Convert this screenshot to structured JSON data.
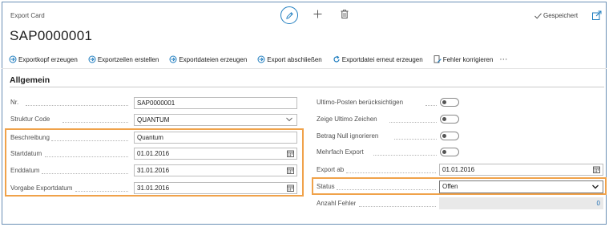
{
  "header": {
    "caption": "Export Card",
    "title": "SAP0000001",
    "saved_label": "Gespeichert"
  },
  "actions": [
    {
      "label": "Exportkopf erzeugen",
      "icon": "arrow-right-circle-icon"
    },
    {
      "label": "Exportzeilen erstellen",
      "icon": "arrow-right-circle-icon"
    },
    {
      "label": "Exportdateien erzeugen",
      "icon": "arrow-right-circle-icon"
    },
    {
      "label": "Export abschließen",
      "icon": "arrow-right-circle-icon"
    },
    {
      "label": "Exportdatei erneut erzeugen",
      "icon": "refresh-icon"
    },
    {
      "label": "Fehler korrigieren",
      "icon": "document-edit-icon"
    }
  ],
  "section": {
    "title": "Allgemein"
  },
  "left_fields": {
    "nr": {
      "label": "Nr.",
      "value": "SAP0000001"
    },
    "struktur": {
      "label": "Struktur Code",
      "value": "QUANTUM"
    },
    "beschreibung": {
      "label": "Beschreibung",
      "value": "Quantum"
    },
    "startdatum": {
      "label": "Startdatum",
      "value": "01.01.2016"
    },
    "enddatum": {
      "label": "Enddatum",
      "value": "31.01.2016"
    },
    "vorgabe": {
      "label": "Vorgabe Exportdatum",
      "value": "31.01.2016"
    }
  },
  "right_fields": {
    "ultimo_posten": {
      "label": "Ultimo-Posten berücksichtigen",
      "on": false
    },
    "ultimo_zeichen": {
      "label": "Zeige Ultimo Zeichen",
      "on": false
    },
    "betrag_null": {
      "label": "Betrag Null ignorieren",
      "on": false
    },
    "mehrfach": {
      "label": "Mehrfach Export",
      "on": false
    },
    "export_ab": {
      "label": "Export ab",
      "value": "01.01.2016"
    },
    "status": {
      "label": "Status",
      "value": "Offen"
    },
    "anzahl_fehler": {
      "label": "Anzahl Fehler",
      "value": "0"
    }
  },
  "colors": {
    "accent": "#1f7dbf",
    "highlight": "#f0a24a",
    "readonly_bg": "#e9e9e9"
  }
}
